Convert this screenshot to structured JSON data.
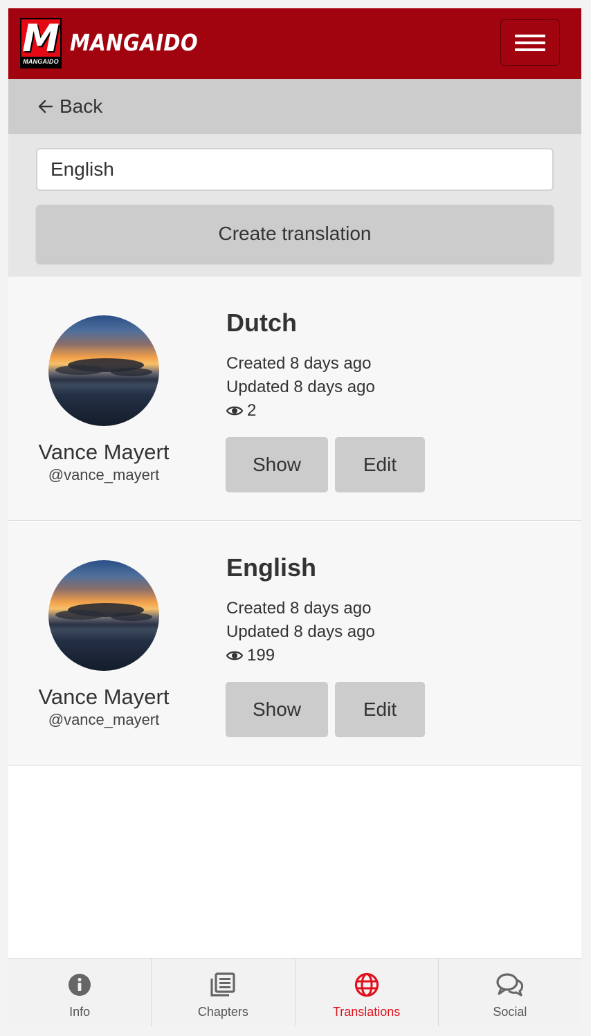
{
  "header": {
    "logo_letter": "M",
    "logo_caption": "MANGAIDO",
    "brand": "MANGAIDO",
    "menu_icon": "hamburger-icon"
  },
  "back": {
    "label": "Back",
    "icon": "arrow-left-icon"
  },
  "form": {
    "language_value": "English",
    "create_label": "Create translation"
  },
  "translations": [
    {
      "language": "Dutch",
      "created": "Created 8 days ago",
      "updated": "Updated 8 days ago",
      "views": "2",
      "user_name": "Vance Mayert",
      "user_handle": "@vance_mayert",
      "show_label": "Show",
      "edit_label": "Edit"
    },
    {
      "language": "English",
      "created": "Created 8 days ago",
      "updated": "Updated 8 days ago",
      "views": "199",
      "user_name": "Vance Mayert",
      "user_handle": "@vance_mayert",
      "show_label": "Show",
      "edit_label": "Edit"
    }
  ],
  "bottom_nav": [
    {
      "label": "Info",
      "icon": "info-icon",
      "active": false
    },
    {
      "label": "Chapters",
      "icon": "chapters-icon",
      "active": false
    },
    {
      "label": "Translations",
      "icon": "globe-icon",
      "active": true
    },
    {
      "label": "Social",
      "icon": "comments-icon",
      "active": false
    }
  ],
  "colors": {
    "brand_red": "#a2040f",
    "active_nav": "#e0101c"
  }
}
